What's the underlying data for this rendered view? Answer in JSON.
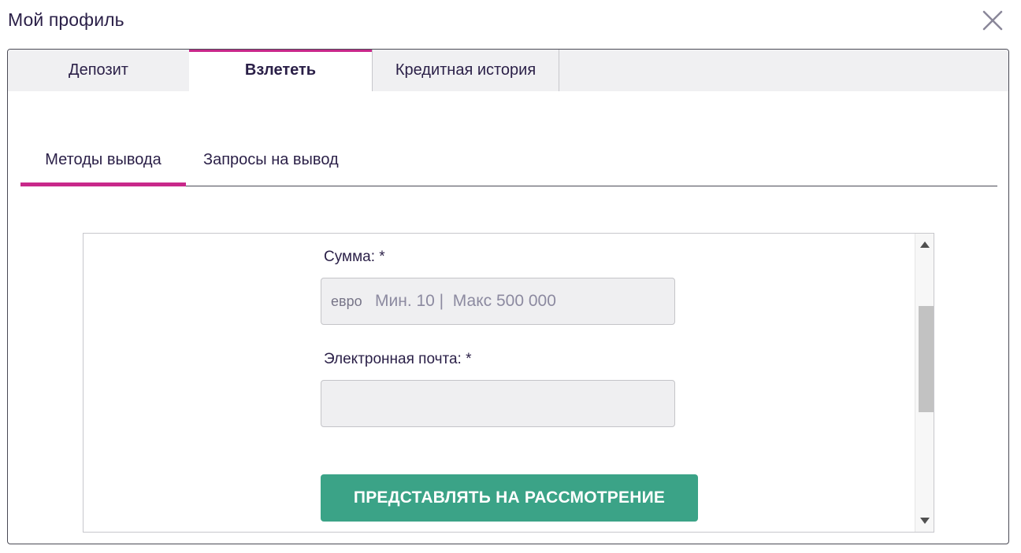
{
  "modal": {
    "title": "Мой профиль",
    "close_icon": "close-icon"
  },
  "tabs": [
    {
      "label": "Депозит",
      "active": false
    },
    {
      "label": "Взлететь",
      "active": true
    },
    {
      "label": "Кредитная история",
      "active": false
    }
  ],
  "subtabs": [
    {
      "label": "Методы вывода",
      "active": true
    },
    {
      "label": "Запросы на вывод",
      "active": false
    }
  ],
  "form": {
    "amount_label": "Сумма: *",
    "amount_currency": "евро",
    "amount_placeholder": "Мин. 10 |  Макс 500 000",
    "amount_value": "",
    "email_label": "Электронная почта: *",
    "email_value": "",
    "submit_label": "ПРЕДСТАВЛЯТЬ НА РАССМОТРЕНИЕ"
  },
  "colors": {
    "accent": "#c8288a",
    "submit": "#3ba387",
    "text": "#2a1f47"
  }
}
